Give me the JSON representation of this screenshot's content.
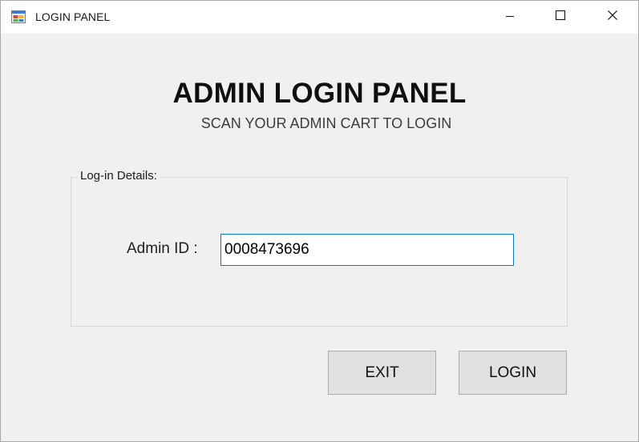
{
  "window": {
    "title": "LOGIN PANEL",
    "icon": "winforms-app-icon",
    "controls": {
      "minimize_icon": "minimize-icon",
      "maximize_icon": "maximize-icon",
      "close_icon": "close-icon"
    }
  },
  "header": {
    "title": "ADMIN LOGIN PANEL",
    "subtitle": "SCAN YOUR ADMIN CART TO LOGIN"
  },
  "login_group": {
    "legend": "Log-in Details:",
    "admin_id_label": "Admin ID :",
    "admin_id_value": "0008473696"
  },
  "buttons": {
    "exit_label": "EXIT",
    "login_label": "LOGIN"
  },
  "colors": {
    "window_bg": "#f0f0f0",
    "titlebar_bg": "#ffffff",
    "focus_border": "#0078d7",
    "button_bg": "#e1e1e1"
  }
}
